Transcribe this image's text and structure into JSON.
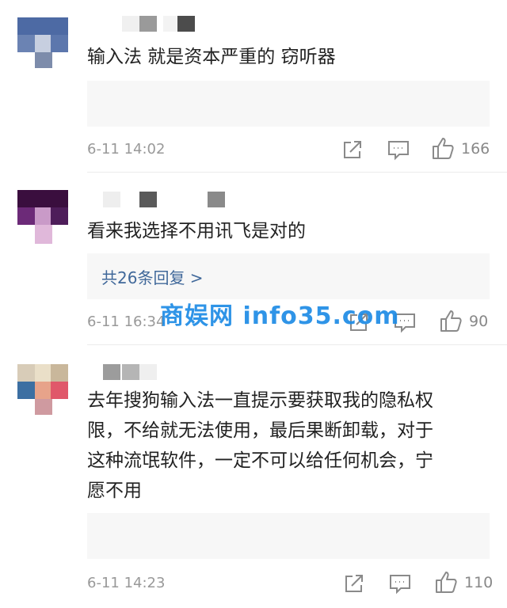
{
  "comments": [
    {
      "text": "输入法 就是资本严重的 窃听器",
      "time": "6-11 14:02",
      "likes": "166"
    },
    {
      "text": "看来我选择不用讯飞是对的",
      "reply": "共26条回复 >",
      "time": "6-11 16:34",
      "likes": "90"
    },
    {
      "lines": [
        "去年搜狗输入法一直提示要获取我的隐私权",
        "限，不给就无法使用，最后果断卸载，对于",
        "这种流氓软件，一定不可以给任何机会，宁",
        "愿不用"
      ],
      "time": "6-11 14:23",
      "likes": "110"
    }
  ],
  "icons": {
    "share": "share-icon",
    "comment": "comment-icon",
    "like": "thumbs-up-icon"
  },
  "colors": {
    "reply_link": "#40689a",
    "meta_text": "#999999",
    "watermark": "#1e8ce6"
  },
  "watermark": "商娱网 info35.com"
}
